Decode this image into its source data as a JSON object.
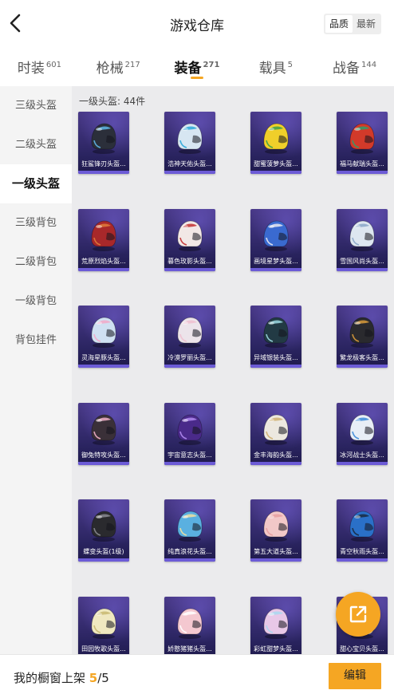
{
  "header": {
    "title": "游戏仓库",
    "sort_options": [
      {
        "label": "品质",
        "active": true
      },
      {
        "label": "最新",
        "active": false
      }
    ]
  },
  "tabs": [
    {
      "label": "时装",
      "count": "601",
      "active": false
    },
    {
      "label": "枪械",
      "count": "217",
      "active": false
    },
    {
      "label": "装备",
      "count": "271",
      "active": true
    },
    {
      "label": "载具",
      "count": "5",
      "active": false
    },
    {
      "label": "战备",
      "count": "144",
      "active": false
    }
  ],
  "sidebar": {
    "items": [
      {
        "label": "三级头盔",
        "active": false
      },
      {
        "label": "二级头盔",
        "active": false
      },
      {
        "label": "一级头盔",
        "active": true
      },
      {
        "label": "三级背包",
        "active": false
      },
      {
        "label": "二级背包",
        "active": false
      },
      {
        "label": "一级背包",
        "active": false
      },
      {
        "label": "背包挂件",
        "active": false
      }
    ]
  },
  "content": {
    "category_label": "一级头盔: 44件",
    "items": [
      {
        "name": "狂鲨锋刃头盔...",
        "color": "#2b2f3a",
        "accent": "#5fb7e8"
      },
      {
        "name": "浩神天佑头盔...",
        "color": "#d7e6f2",
        "accent": "#2aa7d8"
      },
      {
        "name": "甜蜜菠萝头盔...",
        "color": "#f0cf2a",
        "accent": "#3aa04a"
      },
      {
        "name": "福马献瑞头盔...",
        "color": "#d23a2a",
        "accent": "#2f9e6a"
      },
      {
        "name": "荒原烈焰头盔...",
        "color": "#a8282a",
        "accent": "#e07a3a"
      },
      {
        "name": "暮色玫影头盔...",
        "color": "#f2e8e6",
        "accent": "#c23030"
      },
      {
        "name": "画境星梦头盔...",
        "color": "#3a6ad0",
        "accent": "#e8e8f0"
      },
      {
        "name": "雪国风尚头盔...",
        "color": "#dde6f0",
        "accent": "#8aa6c8"
      },
      {
        "name": "灵海星豚头盔...",
        "color": "#cfe0f2",
        "accent": "#f2a8c8"
      },
      {
        "name": "冷漠罗丽头盔...",
        "color": "#ece4ea",
        "accent": "#f0c0d0"
      },
      {
        "name": "异域银装头盔...",
        "color": "#223a44",
        "accent": "#9ad8e0"
      },
      {
        "name": "繁龙极客头盔...",
        "color": "#2a2a2e",
        "accent": "#d89a3a"
      },
      {
        "name": "御兔特攻头盔...",
        "color": "#3a3038",
        "accent": "#f2b0c8"
      },
      {
        "name": "宇宙意志头盔...",
        "color": "#4a2a8a",
        "accent": "#b08af0"
      },
      {
        "name": "金丰海韵头盔...",
        "color": "#ece8e0",
        "accent": "#d0b070"
      },
      {
        "name": "冰河战士头盔...",
        "color": "#e8eef6",
        "accent": "#3a8ad8"
      },
      {
        "name": "蝶变头盔(1级)",
        "color": "#2a2a2e",
        "accent": "#888890"
      },
      {
        "name": "纯真浪花头盔...",
        "color": "#5ab0e0",
        "accent": "#f0e0a0"
      },
      {
        "name": "第五大道头盔...",
        "color": "#f2c8c8",
        "accent": "#e8a0a0"
      },
      {
        "name": "青空秋雨头盔...",
        "color": "#2a70c8",
        "accent": "#1a2a40"
      },
      {
        "name": "田园牧歌头盔...",
        "color": "#efe8c0",
        "accent": "#c8b870"
      },
      {
        "name": "娇憨猪猪头盔...",
        "color": "#f4c8d0",
        "accent": "#ffffff"
      },
      {
        "name": "彩虹甜梦头盔...",
        "color": "#e8c8e8",
        "accent": "#a8d8f0"
      },
      {
        "name": "甜心宝贝头盔...",
        "color": "#e8e8f2",
        "accent": "#f0b0c0"
      }
    ]
  },
  "footer": {
    "label": "我的橱窗上架",
    "current": "5",
    "total": "/5",
    "edit_label": "编辑"
  },
  "icons": {
    "back": "chevron-left-icon",
    "share": "external-link-icon"
  },
  "colors": {
    "accent": "#f5a623",
    "card_bg": "#2a2460",
    "card_bar": "#6c5bd6"
  }
}
